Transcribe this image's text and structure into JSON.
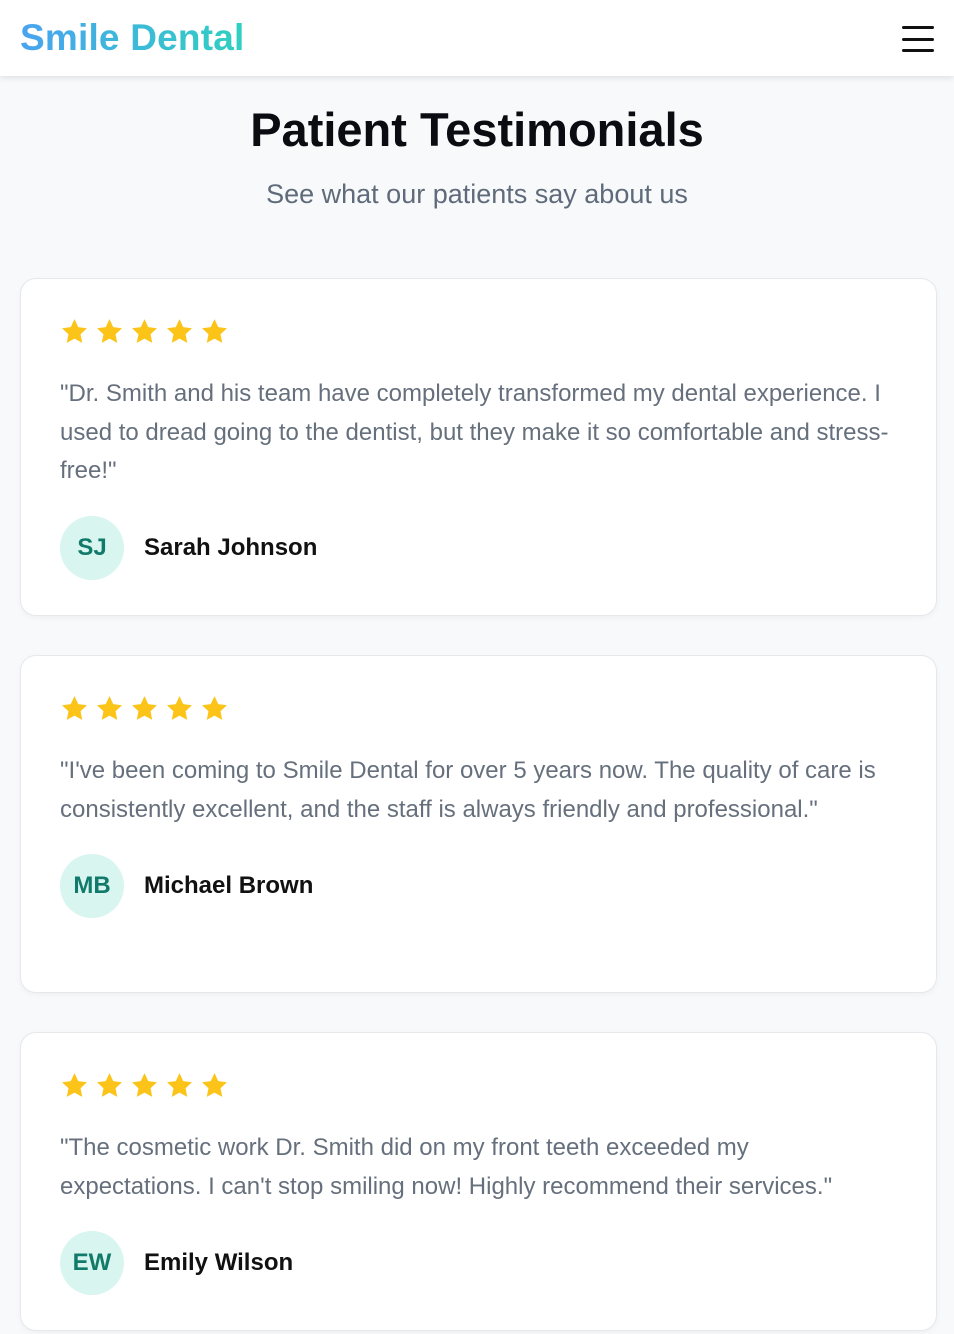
{
  "nav": {
    "brand": "Smile Dental",
    "menu_icon": "hamburger-menu-icon"
  },
  "header": {
    "title": "Patient Testimonials",
    "subtitle": "See what our patients say about us"
  },
  "colors": {
    "star": "#fcc418",
    "avatar_bg": "#d8f5f0",
    "avatar_text": "#127a6a",
    "brand_gradient_start": "#4aa3f0",
    "brand_gradient_end": "#2fd0c0"
  },
  "testimonials": [
    {
      "rating": 5,
      "quote": "\"Dr. Smith and his team have completely transformed my dental experience. I used to dread going to the dentist, but they make it so comfortable and stress-free!\"",
      "initials": "SJ",
      "name": "Sarah Johnson"
    },
    {
      "rating": 5,
      "quote": "\"I've been coming to Smile Dental for over 5 years now. The quality of care is consistently excellent, and the staff is always friendly and professional.\"",
      "initials": "MB",
      "name": "Michael Brown"
    },
    {
      "rating": 5,
      "quote": "\"The cosmetic work Dr. Smith did on my front teeth exceeded my expectations. I can't stop smiling now! Highly recommend their services.\"",
      "initials": "EW",
      "name": "Emily Wilson"
    }
  ]
}
